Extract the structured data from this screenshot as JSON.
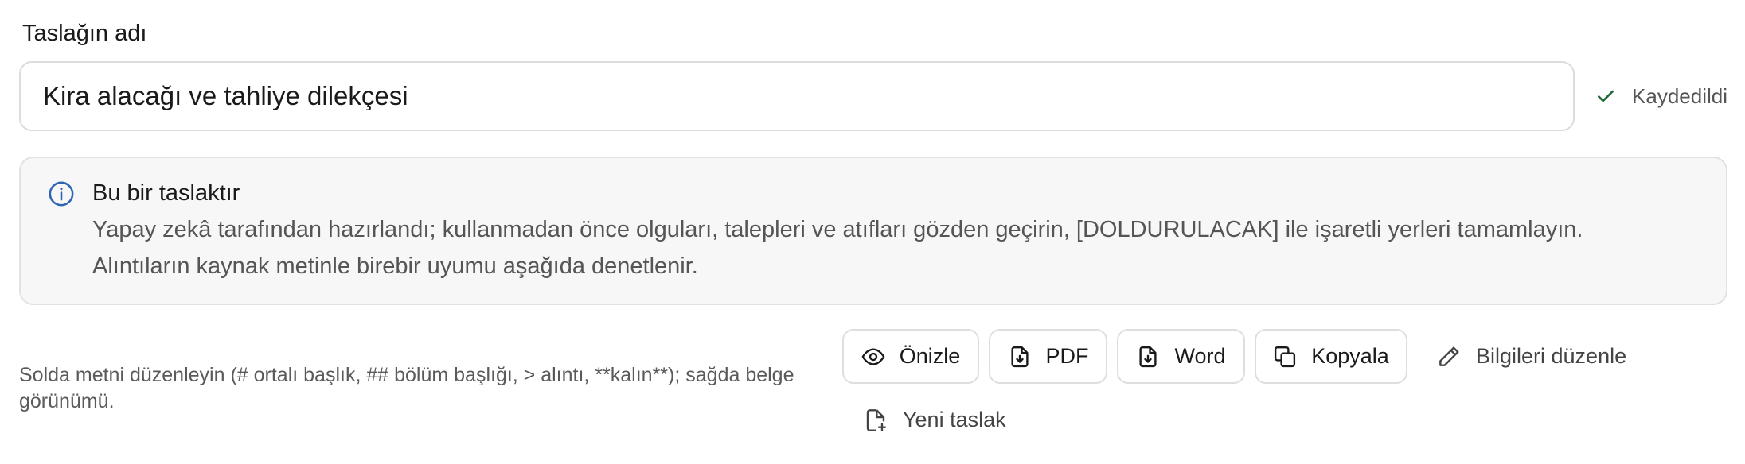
{
  "title_field": {
    "label": "Taslağın adı",
    "value": "Kira alacağı ve tahliye dilekçesi"
  },
  "save_status": {
    "text": "Kaydedildi",
    "icon": "check-icon",
    "color": "#1e6b3a"
  },
  "notice": {
    "icon": "info-icon",
    "icon_color": "#2f66b3",
    "title": "Bu bir taslaktır",
    "line1": "Yapay zekâ tarafından hazırlandı; kullanmadan önce olguları, talepleri ve atıfları gözden geçirin, [DOLDURULACAK] ile işaretli yerleri tamamlayın.",
    "line2": "Alıntıların kaynak metinle birebir uyumu aşağıda denetlenir."
  },
  "hint": "Solda metni düzenleyin (# ortalı başlık, ## bölüm başlığı, > alıntı, **kalın**); sağda belge görünümü.",
  "toolbar": {
    "preview": {
      "label": "Önizle",
      "icon": "eye-icon"
    },
    "pdf": {
      "label": "PDF",
      "icon": "file-download-icon"
    },
    "word": {
      "label": "Word",
      "icon": "file-download-icon"
    },
    "copy": {
      "label": "Kopyala",
      "icon": "copy-icon"
    },
    "edit_info": {
      "label": "Bilgileri düzenle",
      "icon": "pencil-icon"
    },
    "new_draft": {
      "label": "Yeni taslak",
      "icon": "file-plus-icon"
    }
  }
}
